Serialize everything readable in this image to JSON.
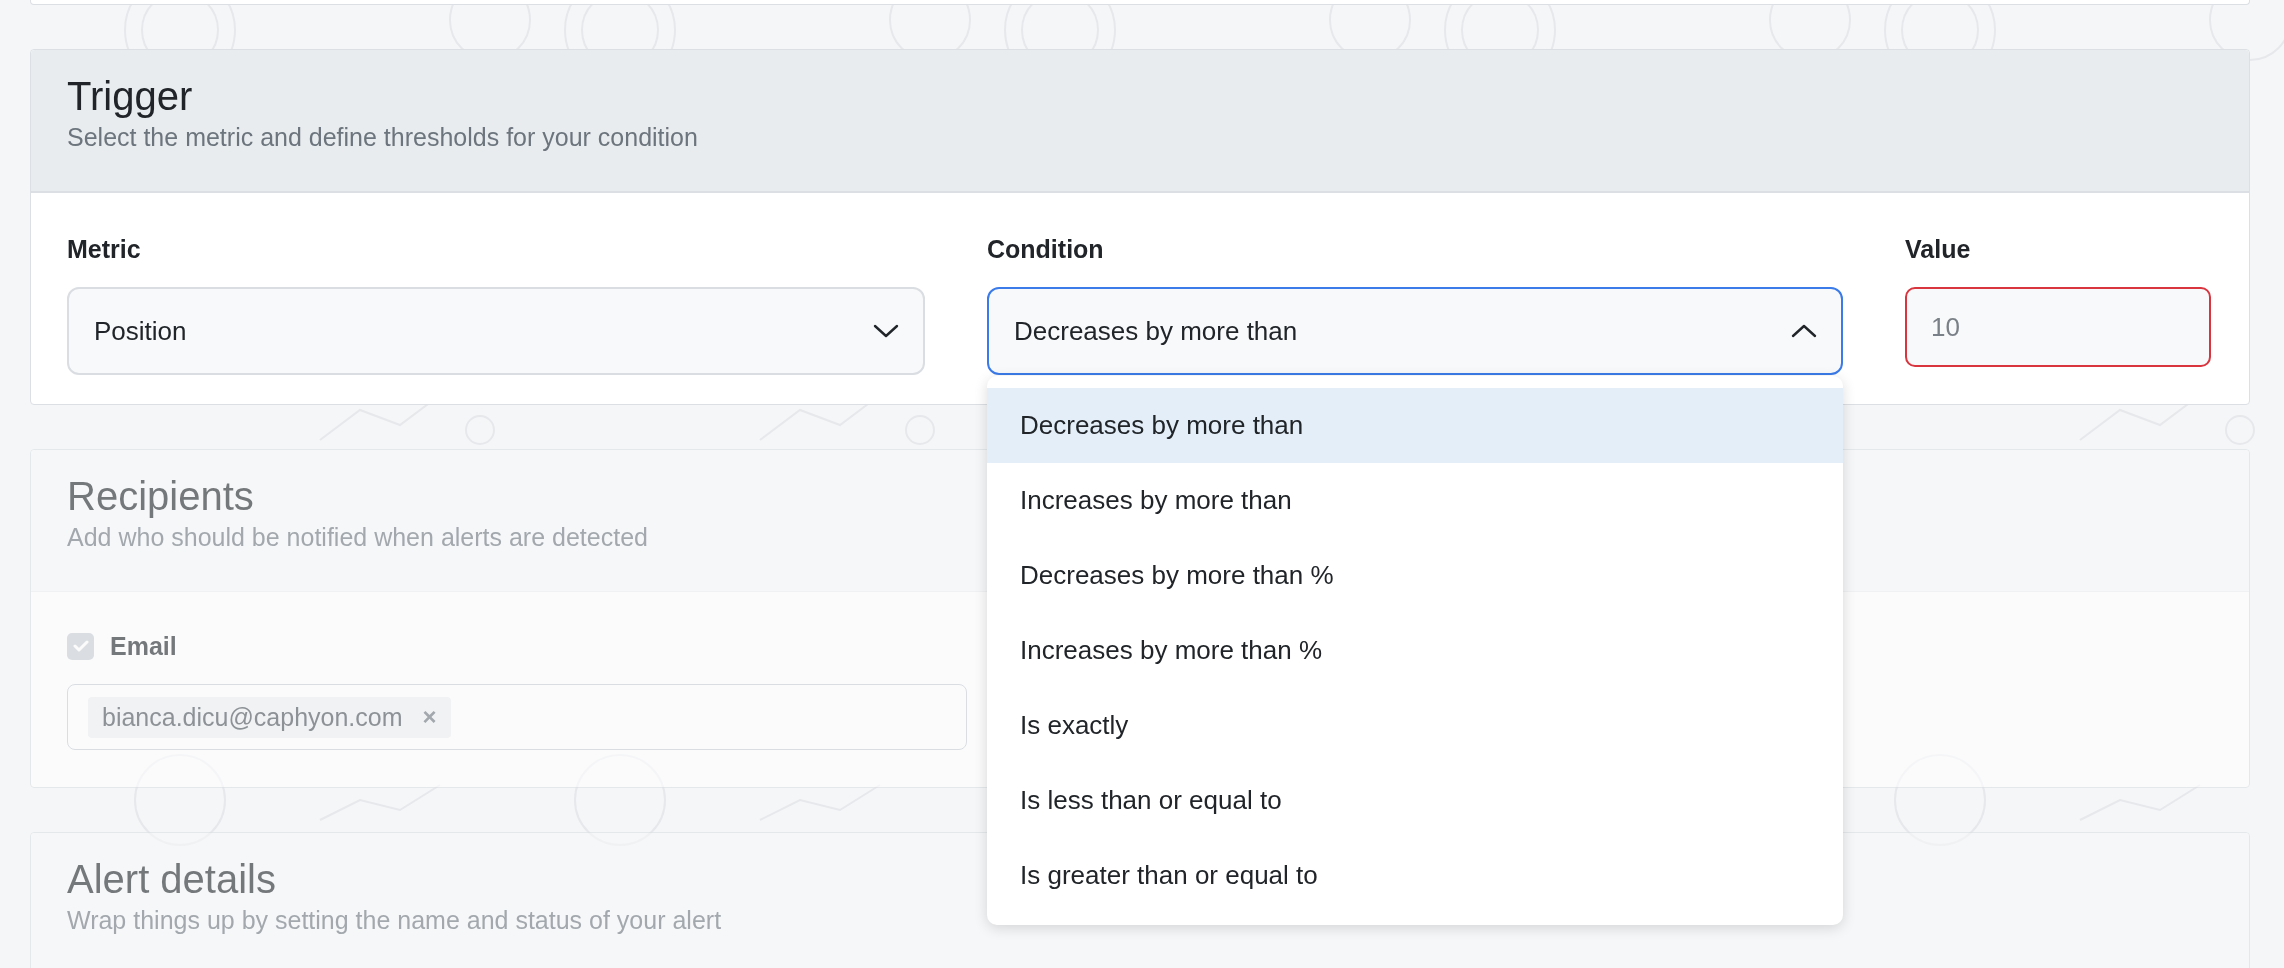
{
  "sections": [
    {
      "kind": "trigger",
      "title": "Trigger",
      "subtitle": "Select the metric and define thresholds for your condition",
      "disabled": false,
      "fields": [
        {
          "kind": "select",
          "label": "Metric",
          "value": "Position",
          "expanded": false
        },
        {
          "kind": "select",
          "label": "Condition",
          "value": "Decreases by more than",
          "expanded": true,
          "options": [
            {
              "label": "Decreases by more than",
              "selected": true
            },
            {
              "label": "Increases by more than",
              "selected": false
            },
            {
              "label": "Decreases by more than %",
              "selected": false
            },
            {
              "label": "Increases by more than %",
              "selected": false
            },
            {
              "label": "Is exactly",
              "selected": false
            },
            {
              "label": "Is less than or equal to",
              "selected": false
            },
            {
              "label": "Is greater than or equal to",
              "selected": false
            }
          ]
        },
        {
          "kind": "text",
          "label": "Value",
          "placeholder": "10",
          "invalid": true
        }
      ]
    },
    {
      "kind": "recipients",
      "title": "Recipients",
      "subtitle": "Add who should be notified when alerts are detected",
      "disabled": true,
      "email": {
        "label": "Email",
        "checked": true,
        "tags": [
          {
            "text": "bianca.dicu@caphyon.com",
            "remove": "×"
          }
        ]
      }
    },
    {
      "kind": "details",
      "title": "Alert details",
      "subtitle": "Wrap things up by setting the name and status of your alert",
      "disabled": true
    }
  ]
}
